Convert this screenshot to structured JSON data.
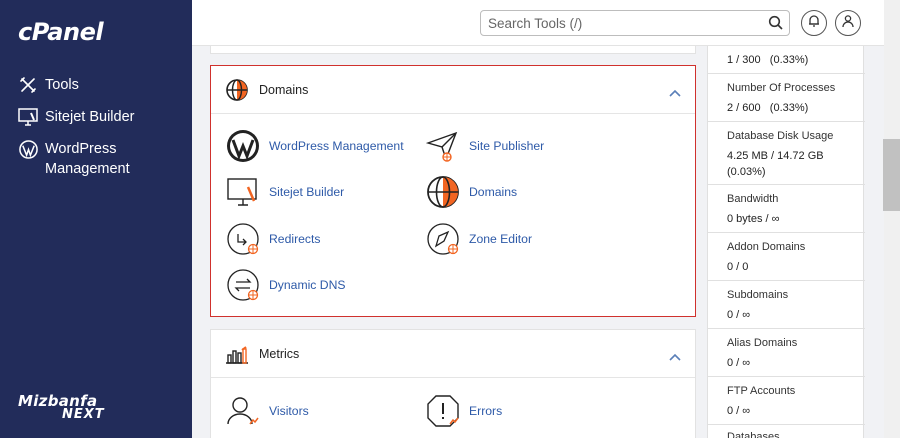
{
  "sidebar": {
    "logo": "cPanel",
    "items": [
      {
        "label": "Tools",
        "icon": "tools-icon"
      },
      {
        "label": "Sitejet Builder",
        "icon": "monitor-icon"
      },
      {
        "label": "WordPress",
        "label2": "Management",
        "icon": "wordpress-icon"
      }
    ],
    "brand_line1": "Mizbanfa",
    "brand_line2": "NEXT"
  },
  "topbar": {
    "search_placeholder": "Search Tools (/)"
  },
  "panels": {
    "domains": {
      "title": "Domains",
      "tools": [
        {
          "label": "WordPress Management",
          "icon": "wordpress-icon"
        },
        {
          "label": "Site Publisher",
          "icon": "paper-plane-icon"
        },
        {
          "label": "Sitejet Builder",
          "icon": "monitor-icon"
        },
        {
          "label": "Domains",
          "icon": "globe-icon"
        },
        {
          "label": "Redirects",
          "icon": "redirect-icon"
        },
        {
          "label": "Zone Editor",
          "icon": "zone-editor-icon"
        },
        {
          "label": "Dynamic DNS",
          "icon": "dynamic-dns-icon"
        }
      ]
    },
    "metrics": {
      "title": "Metrics",
      "tools": [
        {
          "label": "Visitors",
          "icon": "visitors-icon"
        },
        {
          "label": "Errors",
          "icon": "errors-icon"
        }
      ]
    }
  },
  "stats": [
    {
      "label": "",
      "value": "1 / 300   (0.33%)"
    },
    {
      "label": "Number Of Processes",
      "value": "2 / 600   (0.33%)"
    },
    {
      "label": "Database Disk Usage",
      "value": "4.25 MB / 14.72 GB\n(0.03%)"
    },
    {
      "label": "Bandwidth",
      "value": "0 bytes / ∞"
    },
    {
      "label": "Addon Domains",
      "value": "0 / 0"
    },
    {
      "label": "Subdomains",
      "value": "0 / ∞"
    },
    {
      "label": "Alias Domains",
      "value": "0 / ∞"
    },
    {
      "label": "FTP Accounts",
      "value": "0 / ∞"
    },
    {
      "label": "Databases",
      "value": ""
    }
  ],
  "colors": {
    "sidebar_bg": "#222c5a",
    "link": "#2e5aa8",
    "highlight_border": "#d0312d",
    "accent_orange": "#f26522"
  }
}
